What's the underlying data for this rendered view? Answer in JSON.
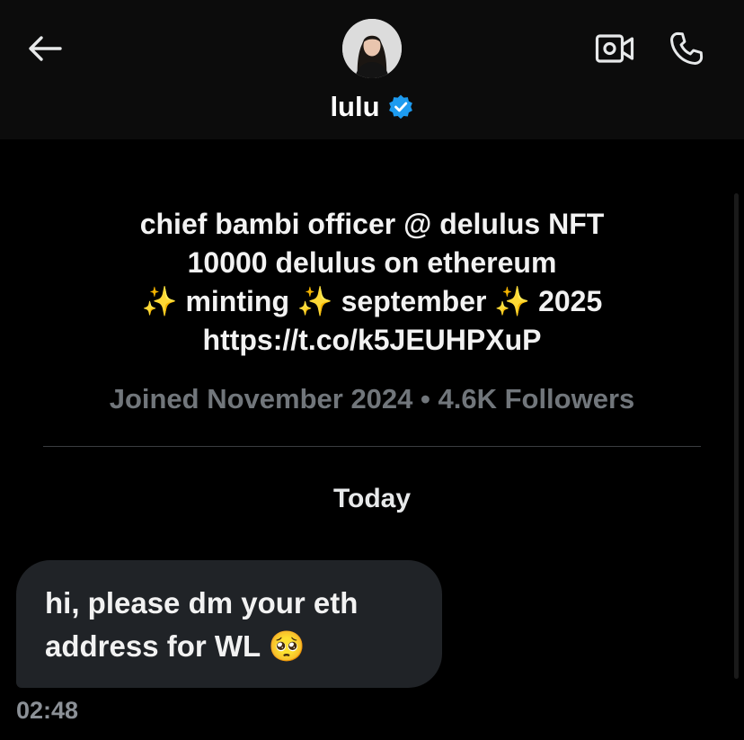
{
  "header": {
    "name": "lulu",
    "back_icon": "arrow-left-icon",
    "video_icon": "video-camera-icon",
    "call_icon": "phone-icon",
    "verified_icon": "verified-badge-icon",
    "verified_color": "#1d9bf0"
  },
  "profile": {
    "bio_lines": [
      "chief bambi officer @ delulus NFT",
      "10000 delulus on ethereum",
      "✨ minting ✨ september ✨ 2025",
      "https://t.co/k5JEUHPXuP"
    ],
    "meta": "Joined November 2024 • 4.6K Followers"
  },
  "conversation": {
    "date_separator": "Today",
    "messages": [
      {
        "lines": [
          "hi, please dm your eth",
          "address for WL 🥺"
        ],
        "time": "02:48"
      }
    ]
  },
  "colors": {
    "background": "#000000",
    "header_background": "#0c0c0c",
    "bubble_background": "#202327",
    "muted_text": "#71767b",
    "accent": "#1d9bf0"
  }
}
